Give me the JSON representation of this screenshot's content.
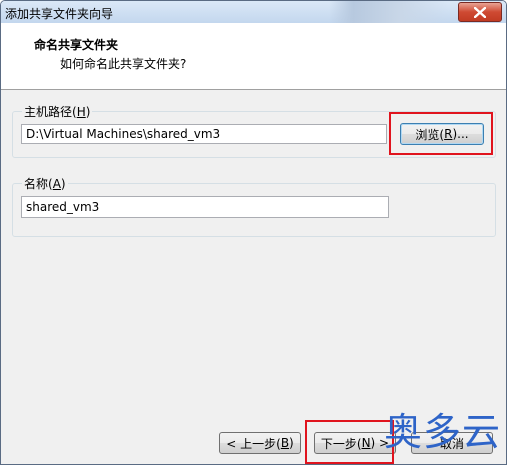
{
  "window": {
    "title": "添加共享文件夹向导",
    "close_icon": "close-icon"
  },
  "header": {
    "title": "命名共享文件夹",
    "subtitle": "如何命名此共享文件夹?"
  },
  "host_path": {
    "label": "主机路径(",
    "label_key": "H",
    "label_end": ")",
    "value": "D:\\Virtual Machines\\shared_vm3",
    "browse_label": "浏览(",
    "browse_key": "R",
    "browse_end": ")..."
  },
  "name": {
    "label": "名称(",
    "label_key": "A",
    "label_end": ")",
    "value": "shared_vm3"
  },
  "footer": {
    "back_label": "< 上一步(",
    "back_key": "B",
    "back_end": ")",
    "next_label": "下一步(",
    "next_key": "N",
    "next_end": ") >",
    "cancel_label": "取消"
  },
  "watermark": {
    "text": "奥多云"
  },
  "colors": {
    "highlight": "#e0141e",
    "watermark": "#2e64c8"
  }
}
